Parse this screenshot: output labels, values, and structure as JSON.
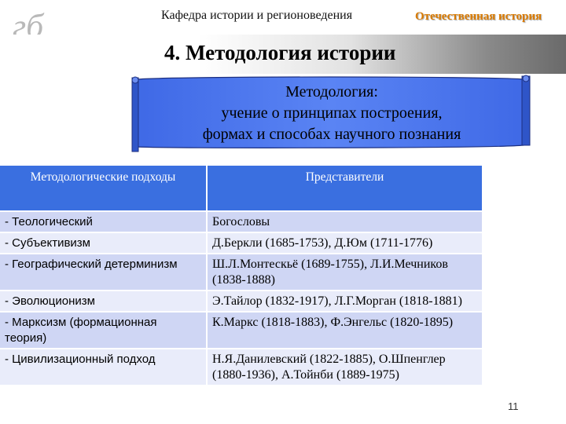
{
  "header": {
    "logo_text": "гб",
    "department": "Кафедра истории и регионоведения",
    "subject": "Отечественная история"
  },
  "title": "4. Методология истории",
  "definition": {
    "line1": "Методология:",
    "line2": "учение о принципах построения,",
    "line3": "формах и способах научного познания"
  },
  "table": {
    "headers": [
      "Методологические подходы",
      "Представители"
    ],
    "rows": [
      {
        "approach": "- Теологический",
        "reps": "Богословы"
      },
      {
        "approach": "- Субъективизм",
        "reps": "Д.Беркли (1685-1753), Д.Юм (1711-1776)"
      },
      {
        "approach": "- Географический детерминизм",
        "reps": "Ш.Л.Монтескьё (1689-1755), Л.И.Мечников (1838-1888)"
      },
      {
        "approach": "- Эволюционизм",
        "reps": "Э.Тайлор (1832-1917), Л.Г.Морган (1818-1881)"
      },
      {
        "approach": "- Марксизм (формационная теория)",
        "reps": "К.Маркс (1818-1883), Ф.Энгельс (1820-1895)"
      },
      {
        "approach": "- Цивилизационный подход",
        "reps": "Н.Я.Данилевский (1822-1885), О.Шпенглер (1880-1936), А.Тойнби (1889-1975)"
      }
    ]
  },
  "page_number": "11",
  "colors": {
    "header_cell": "#3a6fe0",
    "row_odd": "#cfd6f4",
    "row_even": "#e9ecfa",
    "scroll_fill": "#4d78f0",
    "subject_text": "#d97a00"
  }
}
